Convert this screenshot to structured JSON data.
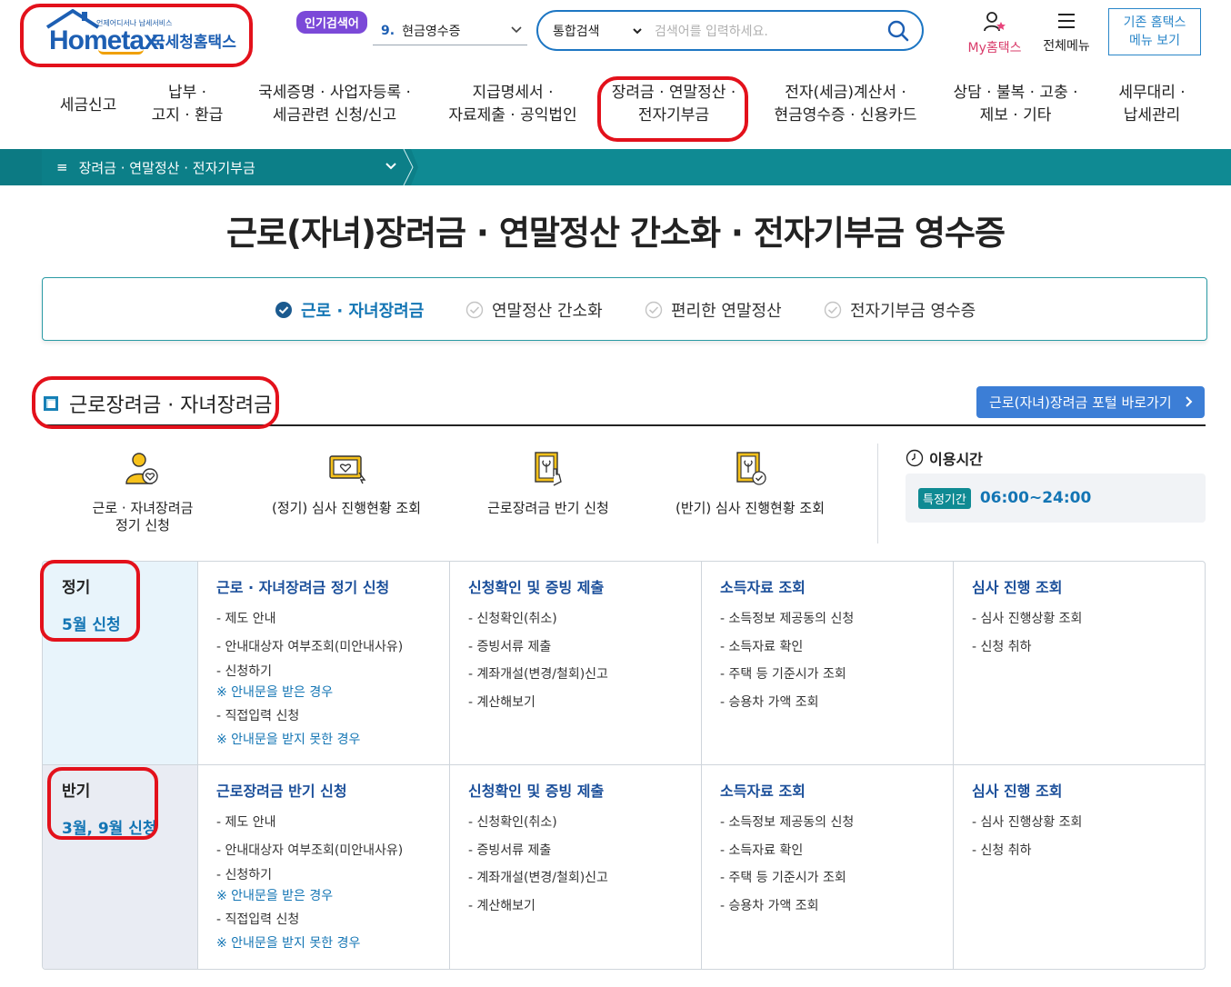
{
  "header": {
    "logo_sub": "언제어디서나 납세서비스",
    "logo_brand_pre": "Hom",
    "logo_brand_e": "e",
    "logo_brand_post": "tax.",
    "logo_agency": "국세청홈택스",
    "popular_badge": "인기검색어",
    "popular_num": "9.",
    "popular_term": "현금영수증",
    "search_scope": "통합검색",
    "search_placeholder": "검색어를 입력하세요.",
    "my_label": "My홈택스",
    "allmenu_label": "전체메뉴",
    "oldmenu_line1": "기존 홈택스",
    "oldmenu_line2": "메뉴 보기"
  },
  "gnb": [
    {
      "l1": "세금신고",
      "l2": ""
    },
    {
      "l1": "납부 ·",
      "l2": "고지 · 환급"
    },
    {
      "l1": "국세증명 · 사업자등록 ·",
      "l2": "세금관련 신청/신고"
    },
    {
      "l1": "지급명세서 ·",
      "l2": "자료제출 · 공익법인"
    },
    {
      "l1": "장려금 · 연말정산 ·",
      "l2": "전자기부금"
    },
    {
      "l1": "전자(세금)계산서 ·",
      "l2": "현금영수증 · 신용카드"
    },
    {
      "l1": "상담 · 불복 · 고충 ·",
      "l2": "제보 · 기타"
    },
    {
      "l1": "세무대리 ·",
      "l2": "납세관리"
    }
  ],
  "breadcrumb": {
    "icon": "≡",
    "label": "장려금 · 연말정산 · 전자기부금"
  },
  "page_title": "근로(자녀)장려금 · 연말정산 간소화 · 전자기부금 영수증",
  "tabs": [
    {
      "label": "근로 · 자녀장려금",
      "active": true
    },
    {
      "label": "연말정산 간소화",
      "active": false
    },
    {
      "label": "편리한 연말정산",
      "active": false
    },
    {
      "label": "전자기부금 영수증",
      "active": false
    }
  ],
  "section": {
    "title": "근로장려금 · 자녀장려금",
    "portal_button": "근로(자녀)장려금 포털 바로가기"
  },
  "quick_links": [
    {
      "l1": "근로 · 자녀장려금",
      "l2": "정기 신청",
      "icon": "person-heart-icon"
    },
    {
      "l1": "(정기) 심사 진행현황 조회",
      "l2": "",
      "icon": "monitor-heart-icon"
    },
    {
      "l1": "근로장려금 반기 신청",
      "l2": "",
      "icon": "document-hand-icon"
    },
    {
      "l1": "(반기) 심사 진행현황 조회",
      "l2": "",
      "icon": "document-check-icon"
    }
  ],
  "usage": {
    "title": "이용시간",
    "tag": "특정기간",
    "time": "06:00~24:00"
  },
  "rows": [
    {
      "head1": "정기",
      "head2": "5월 신청",
      "cols": [
        {
          "title": "근로 · 자녀장려금 정기 신청",
          "items": [
            {
              "text": "- 제도 안내",
              "note": false
            },
            {
              "text": "- 안내대상자 여부조회(미안내사유)",
              "note": false
            },
            {
              "text": "- 신청하기",
              "note": false
            },
            {
              "text": "※ 안내문을 받은 경우",
              "note": true
            },
            {
              "text": "- 직접입력 신청",
              "note": false
            },
            {
              "text": "※ 안내문을 받지 못한 경우",
              "note": true
            }
          ]
        },
        {
          "title": "신청확인 및 증빙 제출",
          "items": [
            {
              "text": "- 신청확인(취소)",
              "note": false
            },
            {
              "text": "- 증빙서류 제출",
              "note": false
            },
            {
              "text": "- 계좌개설(변경/철회)신고",
              "note": false
            },
            {
              "text": "- 계산해보기",
              "note": false
            }
          ]
        },
        {
          "title": "소득자료 조회",
          "items": [
            {
              "text": "- 소득정보 제공동의 신청",
              "note": false
            },
            {
              "text": "- 소득자료 확인",
              "note": false
            },
            {
              "text": "- 주택 등 기준시가 조회",
              "note": false
            },
            {
              "text": "- 승용차 가액 조회",
              "note": false
            }
          ]
        },
        {
          "title": "심사 진행 조회",
          "items": [
            {
              "text": "- 심사 진행상황 조회",
              "note": false
            },
            {
              "text": "- 신청 취하",
              "note": false
            }
          ]
        }
      ]
    },
    {
      "head1": "반기",
      "head2": "3월, 9월 신청",
      "cols": [
        {
          "title": "근로장려금 반기 신청",
          "items": [
            {
              "text": "- 제도 안내",
              "note": false
            },
            {
              "text": "- 안내대상자 여부조회(미안내사유)",
              "note": false
            },
            {
              "text": "- 신청하기",
              "note": false
            },
            {
              "text": "※ 안내문을 받은 경우",
              "note": true
            },
            {
              "text": "- 직접입력 신청",
              "note": false
            },
            {
              "text": "※ 안내문을 받지 못한 경우",
              "note": true
            }
          ]
        },
        {
          "title": "신청확인 및 증빙 제출",
          "items": [
            {
              "text": "- 신청확인(취소)",
              "note": false
            },
            {
              "text": "- 증빙서류 제출",
              "note": false
            },
            {
              "text": "- 계좌개설(변경/철회)신고",
              "note": false
            },
            {
              "text": "- 계산해보기",
              "note": false
            }
          ]
        },
        {
          "title": "소득자료 조회",
          "items": [
            {
              "text": "- 소득정보 제공동의 신청",
              "note": false
            },
            {
              "text": "- 소득자료 확인",
              "note": false
            },
            {
              "text": "- 주택 등 기준시가 조회",
              "note": false
            },
            {
              "text": "- 승용차 가액 조회",
              "note": false
            }
          ]
        },
        {
          "title": "심사 진행 조회",
          "items": [
            {
              "text": "- 심사 진행상황 조회",
              "note": false
            },
            {
              "text": "- 신청 취하",
              "note": false
            }
          ]
        }
      ]
    }
  ],
  "colors": {
    "brand_blue": "#1d5fb3",
    "teal": "#0f8a93",
    "highlight_red": "#e3111b",
    "link_blue": "#1375b4"
  }
}
